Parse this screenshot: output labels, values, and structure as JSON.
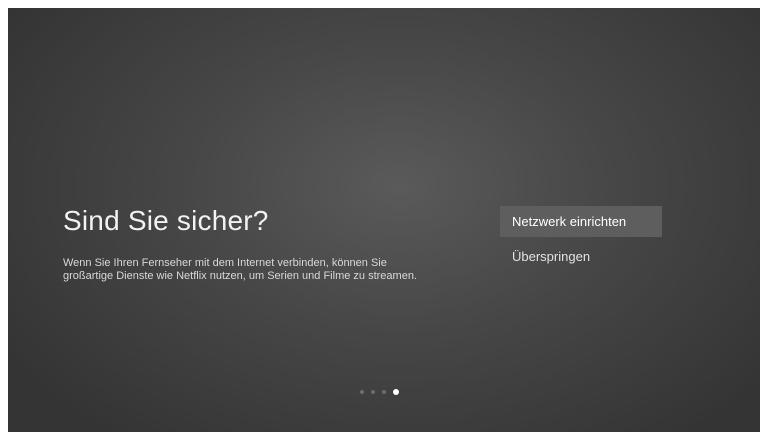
{
  "screen": {
    "title": "Sind Sie sicher?",
    "description": "Wenn Sie Ihren Fernseher mit dem Internet verbinden, können Sie großartige Dienste wie Netflix nutzen, um Serien und Filme zu streamen."
  },
  "menu": {
    "items": [
      {
        "label": "Netzwerk einrichten",
        "selected": true
      },
      {
        "label": "Überspringen",
        "selected": false
      }
    ]
  },
  "pager": {
    "total": 4,
    "current": 4
  },
  "colors": {
    "background": "#474747",
    "highlight": "#5e5e5e",
    "text": "#f2f2f2"
  }
}
